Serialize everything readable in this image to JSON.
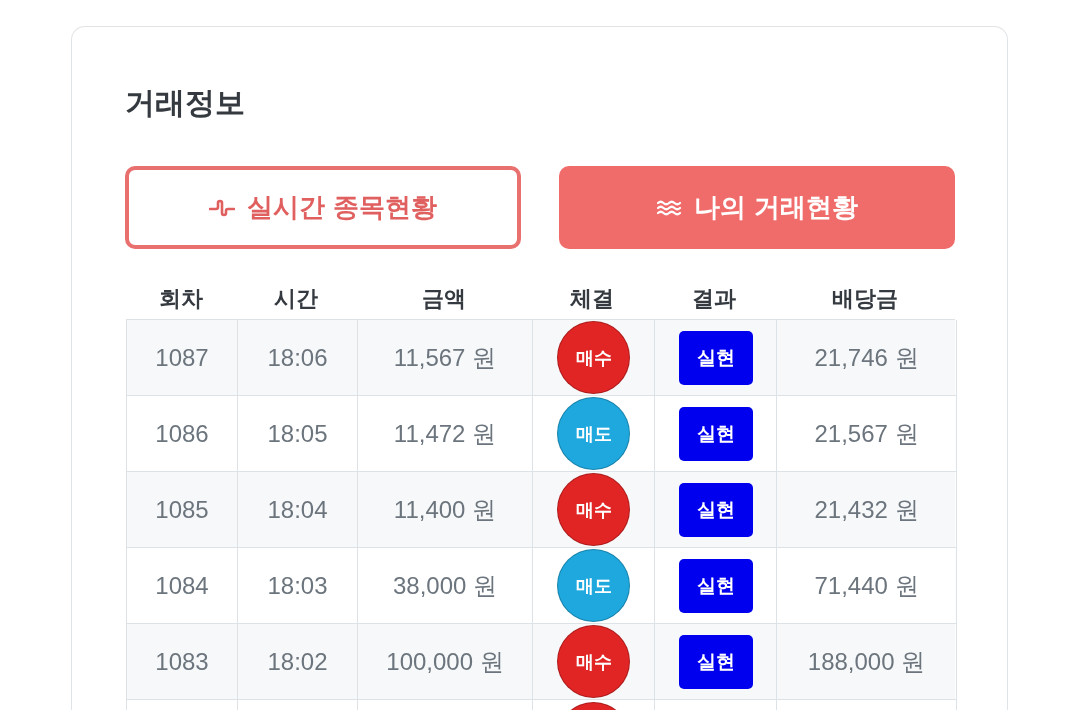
{
  "title": "거래정보",
  "tabs": [
    {
      "label": "실시간 종목현황",
      "selected": false
    },
    {
      "label": "나의 거래현황",
      "selected": true
    }
  ],
  "table": {
    "columns": [
      "회차",
      "시간",
      "금액",
      "체결",
      "결과",
      "배당금"
    ],
    "rows": [
      {
        "round": "1087",
        "time": "18:06",
        "amount": "11,567 원",
        "side": {
          "label": "매수",
          "color": "#e12424"
        },
        "result": "실현",
        "payout": "21,746 원"
      },
      {
        "round": "1086",
        "time": "18:05",
        "amount": "11,472 원",
        "side": {
          "label": "매도",
          "color": "#1ea8dd"
        },
        "result": "실현",
        "payout": "21,567 원"
      },
      {
        "round": "1085",
        "time": "18:04",
        "amount": "11,400 원",
        "side": {
          "label": "매수",
          "color": "#e12424"
        },
        "result": "실현",
        "payout": "21,432 원"
      },
      {
        "round": "1084",
        "time": "18:03",
        "amount": "38,000 원",
        "side": {
          "label": "매도",
          "color": "#1ea8dd"
        },
        "result": "실현",
        "payout": "71,440 원"
      },
      {
        "round": "1083",
        "time": "18:02",
        "amount": "100,000 원",
        "side": {
          "label": "매수",
          "color": "#e12424"
        },
        "result": "실현",
        "payout": "188,000 원"
      },
      {
        "side": {
          "color": "#e12424"
        }
      }
    ]
  }
}
